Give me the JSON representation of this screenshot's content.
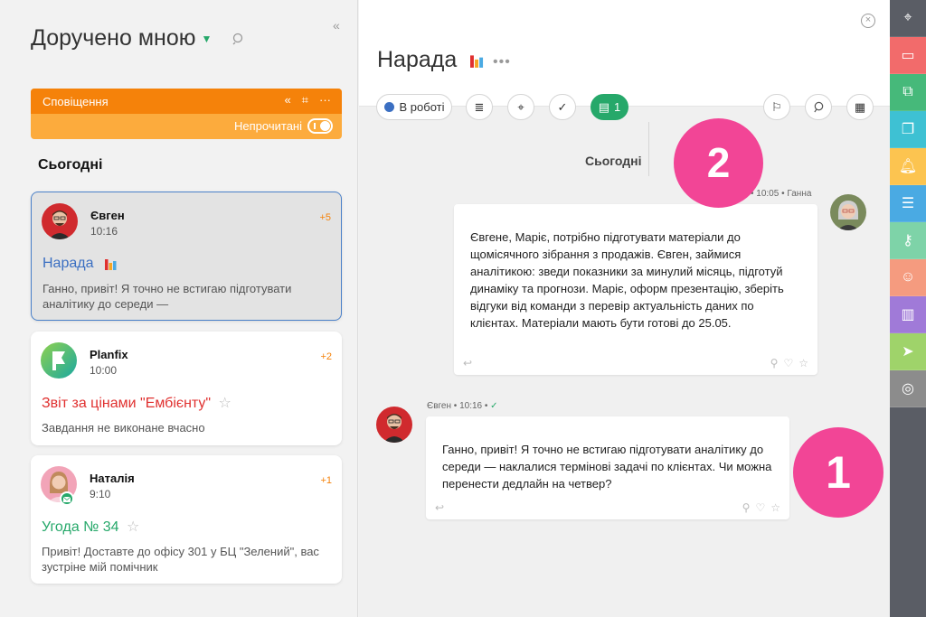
{
  "left": {
    "title": "Доручено мною",
    "notifications": {
      "title": "Сповіщення",
      "unread_label": "Непрочитані"
    },
    "today": "Сьогодні",
    "cards": [
      {
        "name": "Євген",
        "time": "10:16",
        "count": "+5",
        "task": "Нарада",
        "task_color": "#3b6fc2",
        "preview": "Ганно, привіт! Я точно не встигаю підготувати аналітику до середи —"
      },
      {
        "name": "Planfix",
        "time": "10:00",
        "count": "+2",
        "task": "Звіт за цінами \"Ембієнту\"",
        "task_color": "#e0302f",
        "preview": "Завдання не виконане вчасно"
      },
      {
        "name": "Наталія",
        "time": "9:10",
        "count": "+1",
        "task": "Угода № 34",
        "task_color": "#26a86a",
        "preview": "Привіт! Доставте до офісу 301 у БЦ \"Зелений\", вас зустріне мій помічник"
      }
    ]
  },
  "main": {
    "title": "Нарада",
    "status_label": "В роботі",
    "comments_count": "1",
    "today": "Сьогодні",
    "messages": [
      {
        "time": "10:05",
        "author": "Ганна",
        "text": "Євгене, Маріє, потрібно підготувати матеріали до щомісячного зібрання з продажів. Євген, займися аналітикою: зведи показники за минулий місяць, підготуй динаміку та прогнози. Маріє, оформ презентацію, зберіть відгуки від команди з перевір актуальність даних по клієнтах. Матеріали мають бути готові до 25.05."
      },
      {
        "author": "Євген",
        "time": "10:16",
        "text": "Ганно, привіт! Я точно не встигаю підготувати аналітику до середи — наклалися термінові задачі по клієнтах. Чи можна перенести дедлайн на четвер?"
      }
    ]
  },
  "badges": {
    "one": "1",
    "two": "2"
  },
  "colors": {
    "accent_green": "#26a86a",
    "orange": "#f5820a",
    "badge_pink": "#f24596"
  },
  "sidebar_icons": [
    {
      "name": "planfix-logo-icon",
      "color": "#5a5d65"
    },
    {
      "name": "tasks-icon",
      "color": "#f26b6b"
    },
    {
      "name": "projects-icon",
      "color": "#46b97a"
    },
    {
      "name": "documents-icon",
      "color": "#3ec1d3"
    },
    {
      "name": "notifications-icon",
      "color": "#fcc450"
    },
    {
      "name": "reports-icon",
      "color": "#4aaae3"
    },
    {
      "name": "keys-icon",
      "color": "#7ed3a8"
    },
    {
      "name": "contacts-icon",
      "color": "#f59b7f"
    },
    {
      "name": "analytics-icon",
      "color": "#a07ad8"
    },
    {
      "name": "send-icon",
      "color": "#9fd36a"
    },
    {
      "name": "planner-icon",
      "color": "#8c8c8c"
    }
  ]
}
